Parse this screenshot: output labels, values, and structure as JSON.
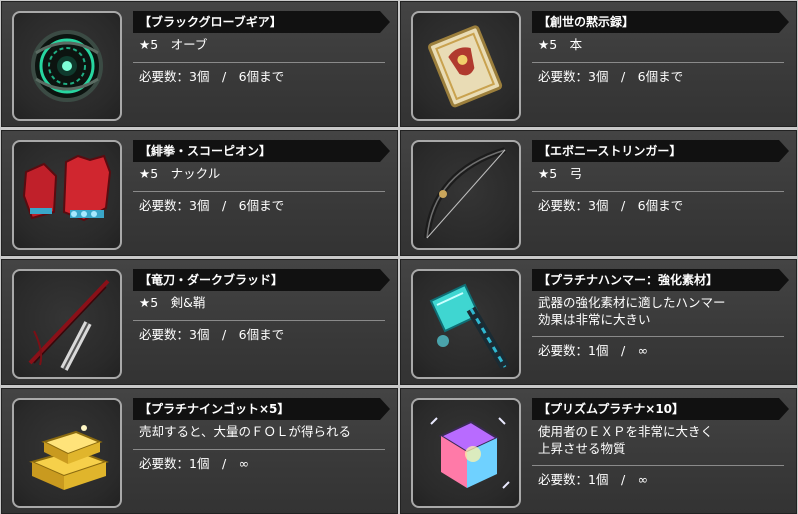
{
  "items": [
    {
      "title": "【ブラックグローブギア】",
      "line1": "★5　オーブ",
      "line2": "",
      "req": "必要数：3個　/　6個まで",
      "icon": "black-globe-gear-orb-icon"
    },
    {
      "title": "【創世の黙示録】",
      "line1": "★5　本",
      "line2": "",
      "req": "必要数：3個　/　6個まで",
      "icon": "apocalypse-book-icon"
    },
    {
      "title": "【緋拳・スコーピオン】",
      "line1": "★5　ナックル",
      "line2": "",
      "req": "必要数：3個　/　6個まで",
      "icon": "scorpion-knuckle-icon"
    },
    {
      "title": "【エボニーストリンガー】",
      "line1": "★5　弓",
      "line2": "",
      "req": "必要数：3個　/　6個まで",
      "icon": "ebony-stringer-bow-icon"
    },
    {
      "title": "【竜刀・ダークブラッド】",
      "line1": "★5　剣&鞘",
      "line2": "",
      "req": "必要数：3個　/　6個まで",
      "icon": "dark-blood-sword-icon"
    },
    {
      "title": "【プラチナハンマー：強化素材】",
      "line1": "武器の強化素材に適したハンマー",
      "line2": "効果は非常に大きい",
      "req": "必要数：1個　/　∞",
      "icon": "platinum-hammer-icon"
    },
    {
      "title": "【プラチナインゴット×5】",
      "line1": "売却すると、大量のＦＯＬが得られる",
      "line2": "",
      "req": "必要数：1個　/　∞",
      "icon": "platinum-ingot-icon"
    },
    {
      "title": "【プリズムプラチナ×10】",
      "line1": "使用者のＥＸＰを非常に大きく",
      "line2": "上昇させる物質",
      "req": "必要数：1個　/　∞",
      "icon": "prism-platinum-icon"
    }
  ]
}
